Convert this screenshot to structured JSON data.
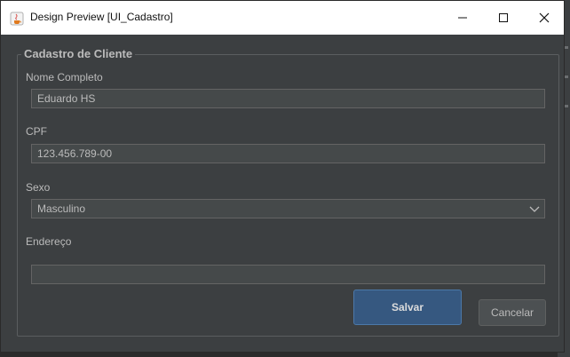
{
  "window": {
    "title": "Design Preview [UI_Cadastro]",
    "app_icon": "java-icon",
    "controls": [
      "minimize-icon",
      "maximize-icon",
      "close-icon"
    ]
  },
  "form": {
    "group_title": "Cadastro de Cliente",
    "fields": [
      {
        "label": "Nome Completo",
        "value": "Eduardo HS"
      },
      {
        "label": "CPF",
        "value": "123.456.789-00"
      },
      {
        "label": "Sexo",
        "value": "Masculino"
      },
      {
        "label": "Endereço",
        "value": ""
      }
    ]
  },
  "buttons": {
    "save": "Salvar",
    "cancel": "Cancelar"
  },
  "colors": {
    "background": "#3c3f41",
    "field_bg": "#45494a",
    "text": "#bbbbbb",
    "primary_button": "#365880",
    "titlebar": "#ffffff"
  }
}
